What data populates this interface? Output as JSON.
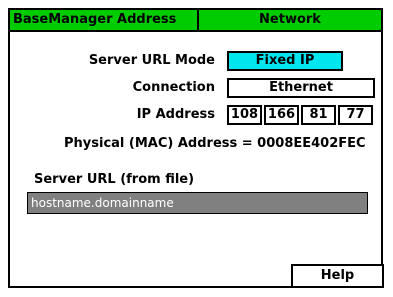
{
  "tabs": {
    "left_label": "BaseManager Address",
    "right_label": "Network"
  },
  "server_url_mode": {
    "label": "Server URL Mode",
    "value": "Fixed IP"
  },
  "connection": {
    "label": "Connection",
    "value": "Ethernet"
  },
  "ip_address": {
    "label": "IP Address",
    "octets": [
      "108",
      "166",
      "81",
      "77"
    ]
  },
  "mac": {
    "text": "Physical (MAC) Address = 0008EE402FEC"
  },
  "server_url_from_file": {
    "label": "Server URL (from file)",
    "value": "hostname.domainname"
  },
  "help_label": "Help",
  "colors": {
    "tab_bg": "#00cc00",
    "highlight_field": "#00e5ee",
    "url_field_bg": "#808080"
  }
}
